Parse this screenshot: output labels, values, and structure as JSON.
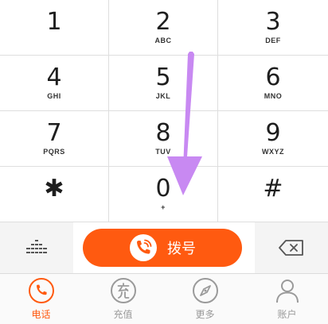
{
  "keypad": {
    "keys": [
      {
        "digit": "1",
        "letters": ""
      },
      {
        "digit": "2",
        "letters": "ABC"
      },
      {
        "digit": "3",
        "letters": "DEF"
      },
      {
        "digit": "4",
        "letters": "GHI"
      },
      {
        "digit": "5",
        "letters": "JKL"
      },
      {
        "digit": "6",
        "letters": "MNO"
      },
      {
        "digit": "7",
        "letters": "PQRS"
      },
      {
        "digit": "8",
        "letters": "TUV"
      },
      {
        "digit": "9",
        "letters": "WXYZ"
      },
      {
        "digit": "✱",
        "letters": ""
      },
      {
        "digit": "0",
        "letters": "+"
      },
      {
        "digit": "#",
        "letters": ""
      }
    ]
  },
  "actions": {
    "dial_label": "拨号",
    "dial_color": "#ff5a10",
    "collapse_icon": "keypad-collapse-icon",
    "delete_icon": "backspace-icon"
  },
  "tabbar": {
    "accent": "#ff5a10",
    "tabs": [
      {
        "label": "电话",
        "icon": "phone-icon",
        "active": true
      },
      {
        "label": "充值",
        "icon": "recharge-icon",
        "active": false
      },
      {
        "label": "更多",
        "icon": "compass-icon",
        "active": false
      },
      {
        "label": "账户",
        "icon": "person-icon",
        "active": false
      }
    ]
  },
  "gesture": {
    "color": "#c889f2",
    "direction": "down"
  }
}
